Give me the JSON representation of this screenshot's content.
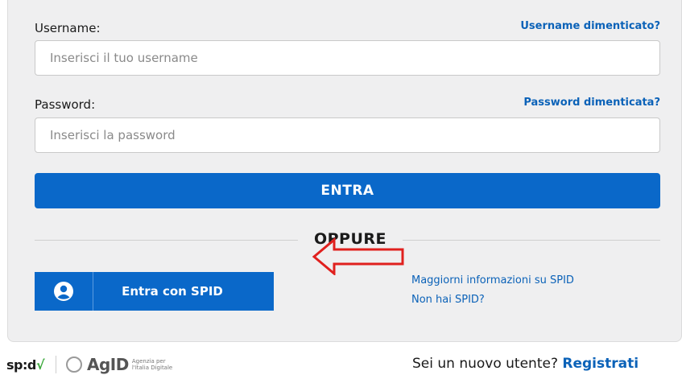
{
  "login": {
    "username_label": "Username:",
    "username_forgot": "Username dimenticato?",
    "username_placeholder": "Inserisci il tuo username",
    "password_label": "Password:",
    "password_forgot": "Password dimenticata?",
    "password_placeholder": "Inserisci la password",
    "submit_label": "ENTRA",
    "or_label": "OPPURE"
  },
  "spid": {
    "button_label": "Entra con SPID",
    "more_info": "Maggiorni informazioni su SPID",
    "no_spid": "Non hai SPID?"
  },
  "footer": {
    "spid_logo": "sp:d",
    "agid_logo": "AgID",
    "agid_subtitle": "Agenzia per l'Italia Digitale",
    "new_user_text": "Sei un nuovo utente?",
    "register_link": "Registrati"
  },
  "colors": {
    "primary": "#0a68c9",
    "link": "#0b62b8",
    "panel_bg": "#efeff0",
    "arrow": "#e0201e"
  },
  "icons": {
    "spid_user": "user-circle-icon",
    "annotation": "red-arrow-left-icon"
  }
}
